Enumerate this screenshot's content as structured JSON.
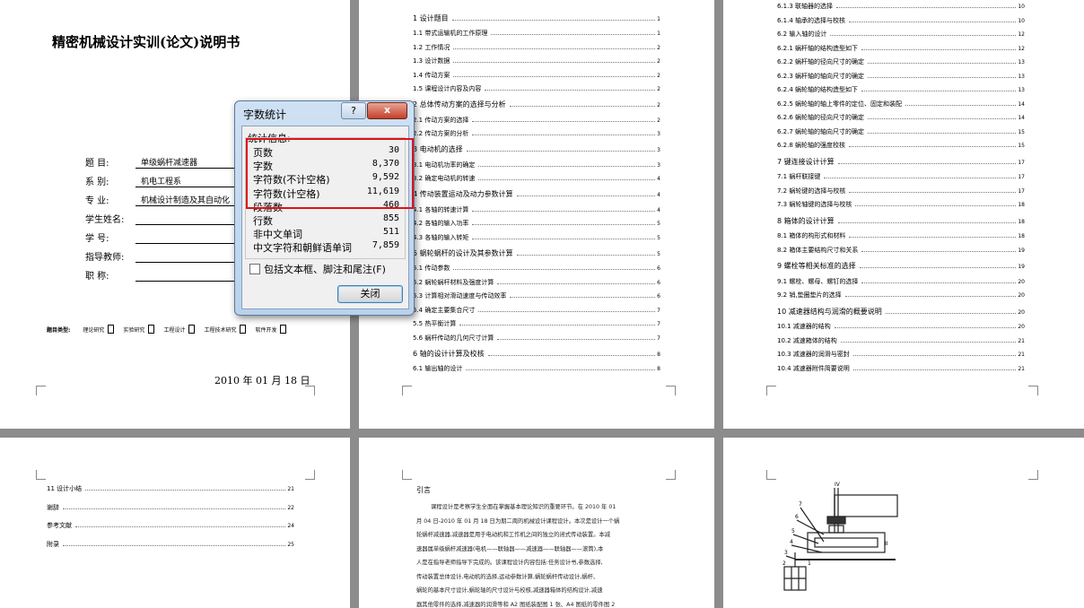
{
  "cover": {
    "title": "精密机械设计实训(论文)说明书",
    "fields": [
      {
        "label": "题    目:",
        "value": "单级蜗杆减速器"
      },
      {
        "label": "系    别:",
        "value": "机电工程系"
      },
      {
        "label": "专    业:",
        "value": "机械设计制造及其自动化"
      },
      {
        "label": "学生姓名:",
        "value": ""
      },
      {
        "label": "学    号:",
        "value": ""
      },
      {
        "label": "指导教师:",
        "value": ""
      },
      {
        "label": "职    称:",
        "value": ""
      }
    ],
    "topic_type_label": "题目类型:",
    "topic_types": [
      "理论研究",
      "实验研究",
      "工程设计",
      "工程技术研究",
      "软件开发"
    ],
    "date": "2010 年 01 月 18 日"
  },
  "toc1": [
    {
      "t": "1   设计题目",
      "p": "1",
      "h": true
    },
    {
      "t": "1.1  带式运输机的工作原理",
      "p": "1"
    },
    {
      "t": "1.2  工作情况",
      "p": "2"
    },
    {
      "t": "1.3  设计数据",
      "p": "2"
    },
    {
      "t": "1.4  传动方案",
      "p": "2"
    },
    {
      "t": "1.5  课程设计内容及内容",
      "p": "2"
    },
    {
      "t": "2   总体传动方案的选择与分析",
      "p": "2",
      "h": true
    },
    {
      "t": "2.1  传动方案的选择",
      "p": "2"
    },
    {
      "t": "2.2  传动方案的分析",
      "p": "3"
    },
    {
      "t": "3   电动机的选择",
      "p": "3",
      "h": true
    },
    {
      "t": "3.1  电动机功率的确定",
      "p": "3"
    },
    {
      "t": "3.2  确定电动机的转速",
      "p": "4"
    },
    {
      "t": "4   传动装置运动及动力参数计算",
      "p": "4",
      "h": true
    },
    {
      "t": "4.1  各轴的转速计算",
      "p": "4"
    },
    {
      "t": "4.2  各轴的输入功率",
      "p": "5"
    },
    {
      "t": "4.3  各轴的输入转矩",
      "p": "5"
    },
    {
      "t": "5   蜗轮蜗杆的设计及其参数计算",
      "p": "5",
      "h": true
    },
    {
      "t": "5.1  传动参数",
      "p": "6"
    },
    {
      "t": "5.2  蜗轮蜗杆材料及强度计算",
      "p": "6"
    },
    {
      "t": "5.3  计算相对滑动速度与传动效率",
      "p": "6"
    },
    {
      "t": "5.4  确定主要集合尺寸",
      "p": "7"
    },
    {
      "t": "5.5  热平衡计算",
      "p": "7"
    },
    {
      "t": "5.6  蜗杆传动的几何尺寸计算",
      "p": "7"
    },
    {
      "t": "6   轴的设计计算及校核",
      "p": "8",
      "h": true
    },
    {
      "t": "6.1  输出轴的设计",
      "p": "8"
    }
  ],
  "toc2": [
    {
      "t": "6.1.3  联轴器的选择",
      "p": "10"
    },
    {
      "t": "6.1.4  轴承的选择与校核",
      "p": "10"
    },
    {
      "t": "6.2   输入轴的设计",
      "p": "12"
    },
    {
      "t": "6.2.1  蜗杆轴的结构造型如下",
      "p": "12"
    },
    {
      "t": "6.2.2  蜗杆轴的径向尺寸的确定",
      "p": "13"
    },
    {
      "t": "6.2.3  蜗杆轴的轴向尺寸的确定",
      "p": "13"
    },
    {
      "t": "6.2.4  蜗轮轴的结构造型如下",
      "p": "13"
    },
    {
      "t": "6.2.5  蜗轮轴的轴上零件的定位、固定和装配",
      "p": "14"
    },
    {
      "t": "6.2.6  蜗轮轴的径向尺寸的确定",
      "p": "14"
    },
    {
      "t": "6.2.7  蜗轮轴的轴向尺寸的确定",
      "p": "15"
    },
    {
      "t": "6.2.8  蜗轮轴的强度校核",
      "p": "15"
    },
    {
      "t": "7   键连接设计计算",
      "p": "17",
      "h": true
    },
    {
      "t": "7.1   蜗杆联接键",
      "p": "17"
    },
    {
      "t": "7.2   蜗轮键的选择与校核",
      "p": "17"
    },
    {
      "t": "7.3   蜗轮轴键的选择与校核",
      "p": "18"
    },
    {
      "t": "8   箱体的设计计算",
      "p": "18",
      "h": true
    },
    {
      "t": "8.1   箱体的构形式和材料",
      "p": "18"
    },
    {
      "t": "8.2   箱体主要结构尺寸和关系",
      "p": "19"
    },
    {
      "t": "9   螺栓等相关标准的选择",
      "p": "19",
      "h": true
    },
    {
      "t": "9.1   螺栓、螺母、螺钉的选择",
      "p": "20"
    },
    {
      "t": "9.2   销,垫圈垫片的选择",
      "p": "20"
    },
    {
      "t": "10   减速器结构与润滑的概要说明",
      "p": "20",
      "h": true
    },
    {
      "t": "10.1  减速器的结构",
      "p": "20"
    },
    {
      "t": "10.2  减速箱体的结构",
      "p": "21"
    },
    {
      "t": "10.3  减速器的润滑与密封",
      "p": "21"
    },
    {
      "t": "10.4  减速器附件简要说明",
      "p": "21"
    }
  ],
  "toc3": [
    {
      "t": "11   设计小结",
      "p": "21"
    },
    {
      "t": "谢辞",
      "p": "22"
    },
    {
      "t": "参考文献",
      "p": "24"
    },
    {
      "t": "附录",
      "p": "25"
    }
  ],
  "intro": {
    "heading": "引言",
    "lines": [
      "        课程设计是考察学生全面在掌握基本理论知识的重要环节。在 2010 年 01",
      "月 04 日-2010 年 01 月 18 日为期二周的机械设计课程设计。本次是设计一个蜗",
      "轮蜗杆减速器,减速器是用于电动机和工作机之间的独立的闭式传动装置。本减",
      "速器属单级蜗杆减速器(电机——联轴器——减速器——联轴器——滚筒),本",
      "人是在指导老师指导下完成的。该课程设计内容包括:任务设计书,参数选择,",
      "传动装置总体设计,电动机的选择,运动参数计算,蜗轮蜗杆传动设计,蜗杆、",
      "蜗轮的基本尺寸设计,蜗轮轴的尺寸设计与校核,减速器箱体的结构设计,减速",
      "器其他零件的选择,减速器的润滑等和 A2 图纸装配图 1 张、A4 图纸的零件图 2"
    ]
  },
  "figure": {
    "labels": [
      "IV",
      "7",
      "6",
      "5",
      "4",
      "3",
      "2",
      "1",
      "II"
    ]
  },
  "dialog": {
    "title": "字数统计",
    "help_glyph": "?",
    "close_glyph": "x",
    "group_label": "统计信息:",
    "stats": [
      {
        "label": "页数",
        "value": "30"
      },
      {
        "label": "字数",
        "value": "8,370"
      },
      {
        "label": "字符数(不计空格)",
        "value": "9,592"
      },
      {
        "label": "字符数(计空格)",
        "value": "11,619"
      },
      {
        "label": "段落数",
        "value": "460"
      },
      {
        "label": "行数",
        "value": "855"
      },
      {
        "label": "非中文单词",
        "value": "511"
      },
      {
        "label": "中文字符和朝鲜语单词",
        "value": "7,859"
      }
    ],
    "checkbox_label": "包括文本框、脚注和尾注(F)",
    "close_button": "关闭",
    "highlight_color": "#e0101a"
  }
}
